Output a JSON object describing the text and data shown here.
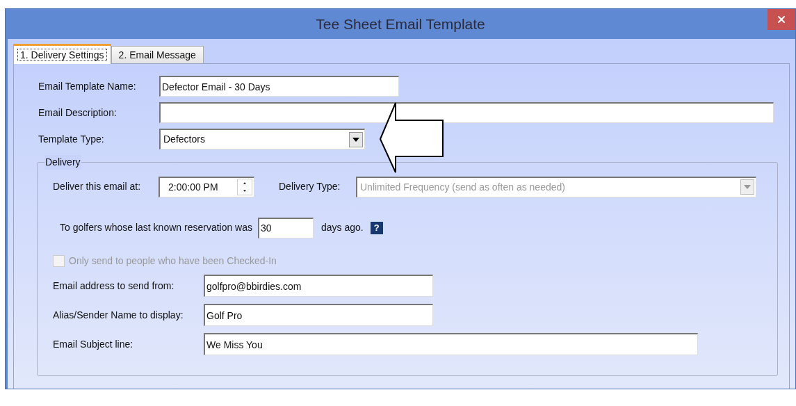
{
  "window": {
    "title": "Tee Sheet Email Template"
  },
  "tabs": [
    {
      "label": "1. Delivery Settings",
      "selected": true
    },
    {
      "label": "2. Email Message",
      "selected": false
    }
  ],
  "fields": [
    {
      "kind": "text",
      "label": "Email Template Name:",
      "value": "Defector Email - 30 Days"
    },
    {
      "kind": "text",
      "label": "Email Description:"
    },
    {
      "kind": "select",
      "label": "Template Type:",
      "value": "Defectors"
    }
  ],
  "delivery": {
    "title": "Delivery",
    "time_label": "Deliver this email at:",
    "time_value": "2:00:00 PM",
    "type_label": "Delivery Type:",
    "type_value": "Unlimited Frequency (send as often as needed)",
    "type_disabled": true,
    "days_prefix": "To golfers whose last known reservation was",
    "days_value": "30",
    "days_suffix": "days ago.",
    "help": "?",
    "checkbox": {
      "label": "Only send to people who have been Checked-In",
      "checked": false,
      "disabled": true
    },
    "fields": [
      {
        "label": "Email address to send from:",
        "value": "golfpro@bbirdies.com"
      },
      {
        "label": "Alias/Sender Name to display:",
        "value": "Golf Pro"
      },
      {
        "label": "Email Subject line:",
        "value": "We Miss You"
      }
    ]
  }
}
